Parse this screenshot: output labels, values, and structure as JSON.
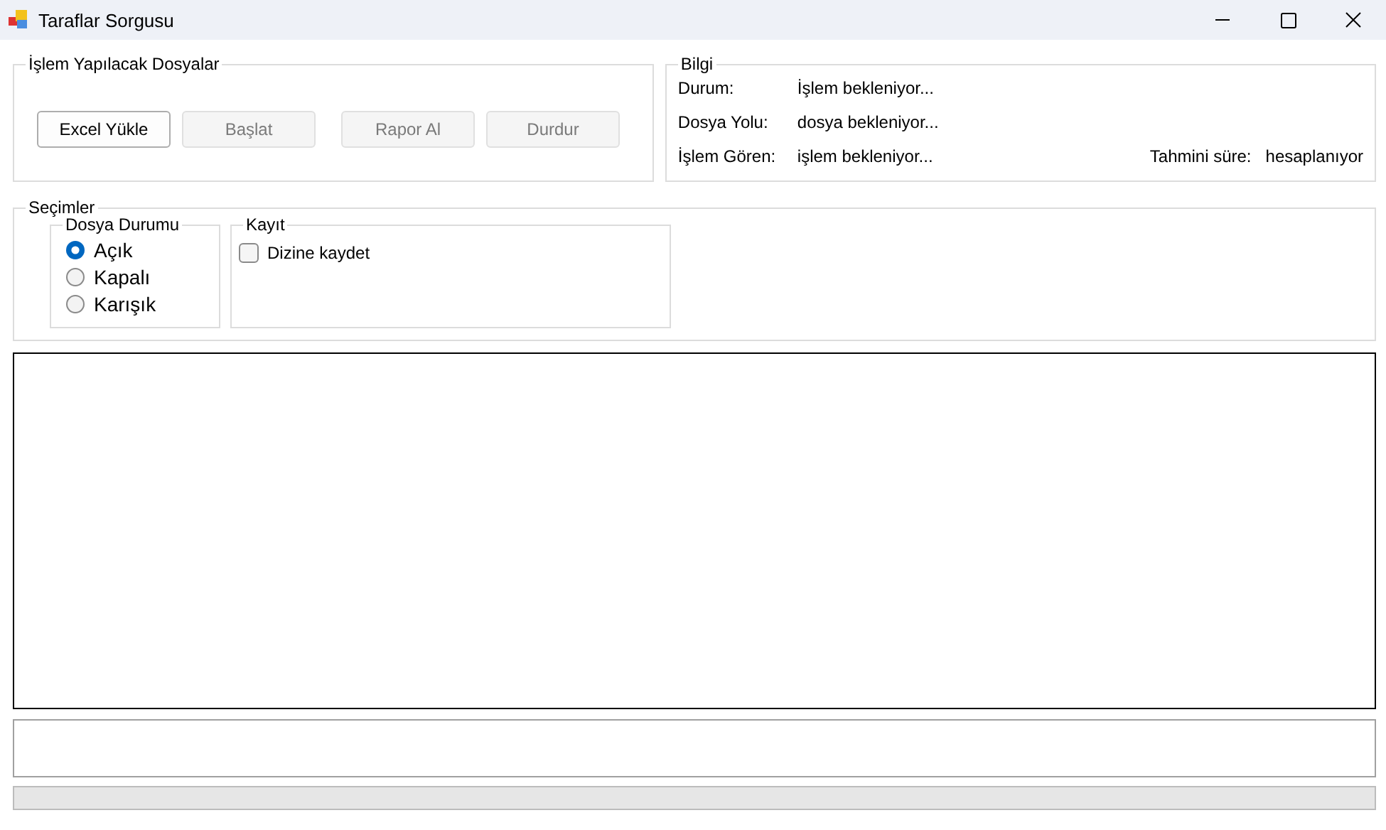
{
  "window": {
    "title": "Taraflar Sorgusu"
  },
  "files_group": {
    "title": "İşlem Yapılacak Dosyalar",
    "buttons": [
      {
        "label": "Excel Yükle",
        "disabled": false
      },
      {
        "label": "Başlat",
        "disabled": true
      },
      {
        "label": "Rapor Al",
        "disabled": true
      },
      {
        "label": "Durdur",
        "disabled": true
      }
    ]
  },
  "info_group": {
    "title": "Bilgi",
    "rows": [
      {
        "label": "Durum:",
        "value": "İşlem bekleniyor..."
      },
      {
        "label": "Dosya Yolu:",
        "value": "dosya bekleniyor..."
      },
      {
        "label": "İşlem Gören:",
        "value": "işlem bekleniyor..."
      }
    ],
    "estimate": {
      "label": "Tahmini süre:",
      "value": "hesaplanıyor"
    }
  },
  "options_group": {
    "title": "Seçimler",
    "file_status": {
      "title": "Dosya Durumu",
      "options": [
        {
          "label": "Açık",
          "selected": true
        },
        {
          "label": "Kapalı",
          "selected": false
        },
        {
          "label": "Karışık",
          "selected": false
        }
      ]
    },
    "save": {
      "title": "Kayıt",
      "checkbox": {
        "label": "Dizine kaydet",
        "checked": false
      }
    }
  },
  "progress": {
    "level": 0
  }
}
